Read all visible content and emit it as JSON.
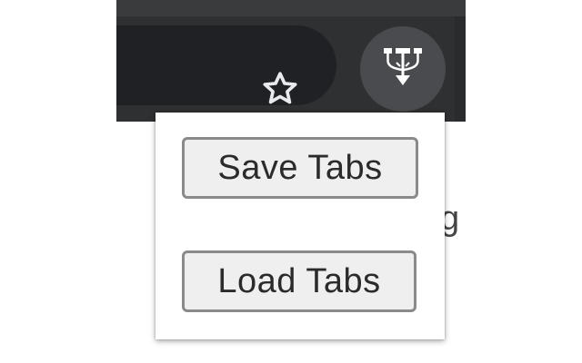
{
  "browser": {
    "bookmark_icon": "star-icon",
    "extension_icon": "tab-tree-icon"
  },
  "popup": {
    "save_label": "Save Tabs",
    "load_label": "Load Tabs"
  },
  "background": {
    "partial_text": "ge"
  },
  "colors": {
    "chrome_dark": "#2f3032",
    "omnibox": "#202124",
    "extension_button_bg": "#4a4b4e",
    "button_bg": "#efefef",
    "button_border": "#8a8a8a"
  }
}
